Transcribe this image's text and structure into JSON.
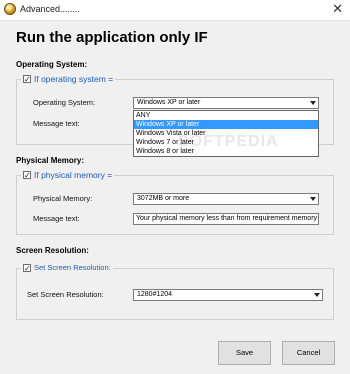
{
  "window": {
    "title": "Advanced........"
  },
  "heading": "Run the application only IF",
  "os_section": {
    "title": "Operating System:",
    "checkbox_label": "If operating system =",
    "checked": true,
    "os_label": "Operating System:",
    "os_value": "Windows XP or later",
    "message_label": "Message text:",
    "dropdown_options": [
      "ANY",
      "Windows XP or later",
      "Windows Vista or later",
      "Windows 7 or later",
      "Windows 8 or later"
    ],
    "selected_option": "Windows XP or later"
  },
  "memory_section": {
    "title": "Physical Memory:",
    "checkbox_label": "If physical memory =",
    "checked": true,
    "memory_label": "Physical Memory:",
    "memory_value": "3072MB or more",
    "message_label": "Message text:",
    "message_value": "Your physical memory less than from requirement memory"
  },
  "resolution_section": {
    "title": "Screen Resolution:",
    "checkbox_label": "Set Screen Resolution:",
    "checked": true,
    "resolution_label": "Set Screen Resolution:",
    "resolution_value": "1280#1204"
  },
  "buttons": {
    "save": "Save",
    "cancel": "Cancel"
  },
  "watermark": "SOFTPEDIA",
  "colors": {
    "accent_blue": "#1a5fb4",
    "selection": "#3399ff"
  }
}
